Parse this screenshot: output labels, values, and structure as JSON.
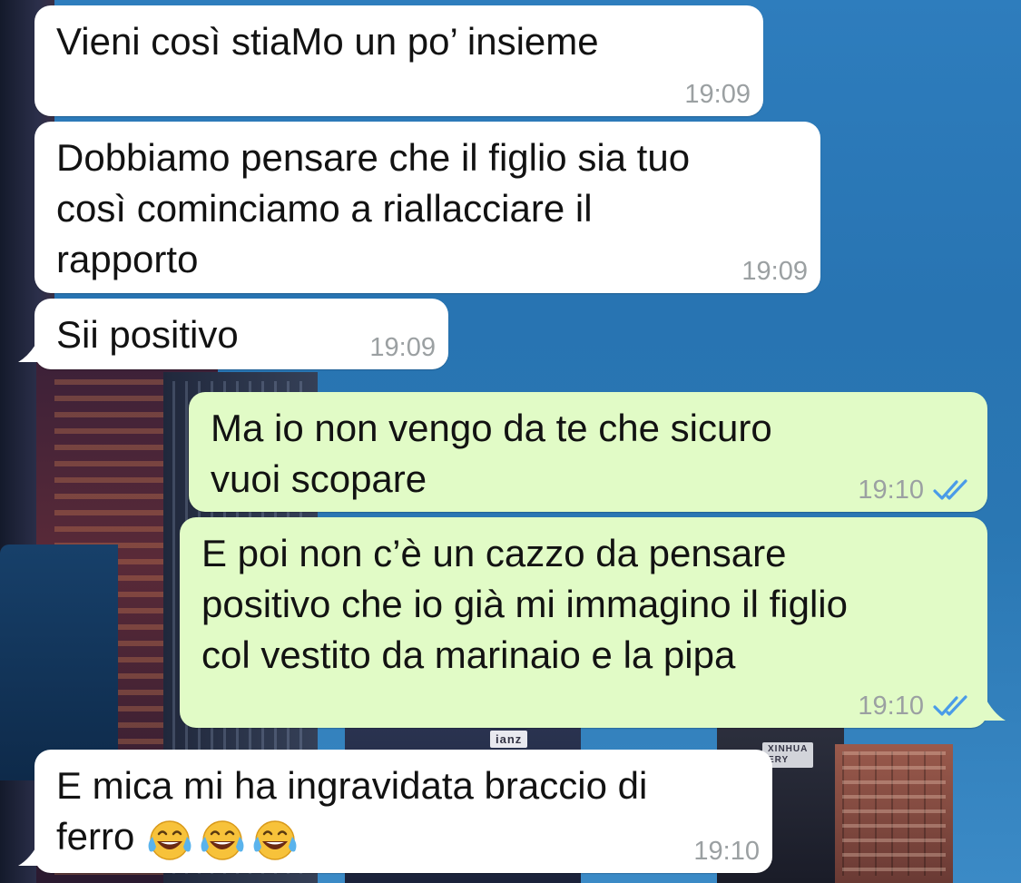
{
  "messages": [
    {
      "direction": "incoming",
      "text": "Vieni così stiaMo un po’ insieme",
      "time": "19:09"
    },
    {
      "direction": "incoming",
      "text": "Dobbiamo pensare che il figlio sia tuo\ncosì cominciamo a riallacciare il\nrapporto",
      "time": "19:09"
    },
    {
      "direction": "incoming",
      "text": "Sii positivo",
      "time": "19:09"
    },
    {
      "direction": "outgoing",
      "text": "Ma io non vengo da te che sicuro\nvuoi scopare",
      "time": "19:10",
      "status_icon": "double-check-read-icon"
    },
    {
      "direction": "outgoing",
      "text": "E poi non c’è un cazzo da pensare\npositivo che io già mi immagino il figlio\ncol vestito da marinaio e la pipa",
      "time": "19:10",
      "status_icon": "double-check-read-icon"
    },
    {
      "direction": "incoming",
      "text": "E mica mi ha ingravidata braccio di\nferro",
      "emoji": [
        "face-with-tears-of-joy",
        "face-with-tears-of-joy",
        "face-with-tears-of-joy"
      ],
      "time": "19:10"
    }
  ],
  "background_signs": {
    "sign_a": "ianz",
    "sign_b": "XINHUA\nERY"
  },
  "colors": {
    "incoming_bubble": "#ffffff",
    "outgoing_bubble": "#e1fbc6",
    "timestamp": "#9ba0a2",
    "read_ticks": "#4a9be8"
  }
}
